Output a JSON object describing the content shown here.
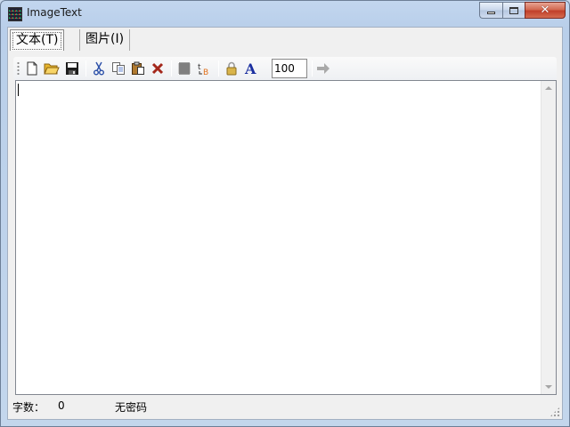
{
  "window": {
    "title": "ImageText"
  },
  "tabs": [
    {
      "label": "文本(T)",
      "active": true
    },
    {
      "label": "图片(I)",
      "active": false
    }
  ],
  "toolbar": {
    "buttons": [
      "new-file-icon",
      "open-folder-icon",
      "save-icon",
      "cut-icon",
      "copy-icon",
      "paste-icon",
      "delete-icon",
      "grid-icon",
      "text-encode-icon",
      "lock-icon",
      "font-icon",
      "next-arrow-icon"
    ],
    "zoom_value": "100"
  },
  "editor": {
    "content": ""
  },
  "status": {
    "char_count_label": "字数：",
    "char_count": "0",
    "password_status": "无密码"
  },
  "colors": {
    "titlebar": "#c2d6ef",
    "close_button": "#c1402a",
    "client_bg": "#f0f0f0",
    "font_icon": "#1a2fa0",
    "delete_icon": "#a4271b"
  }
}
